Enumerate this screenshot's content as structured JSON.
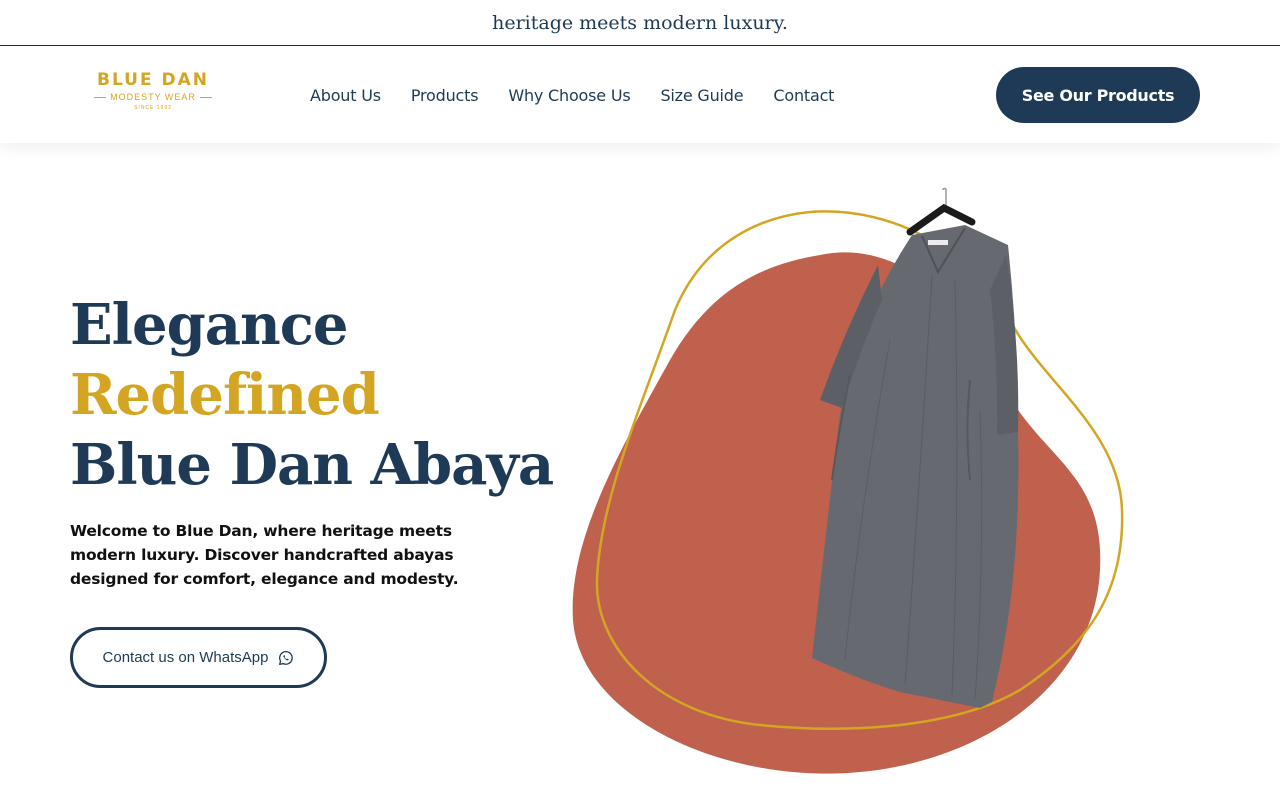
{
  "topbar": {
    "text": "heritage meets modern luxury."
  },
  "logo": {
    "title": "BLUE DAN",
    "subtitle": "MODESTY WEAR",
    "since": "SINCE 1992"
  },
  "nav": {
    "items": [
      {
        "label": "About Us"
      },
      {
        "label": "Products"
      },
      {
        "label": "Why Choose Us"
      },
      {
        "label": "Size Guide"
      },
      {
        "label": "Contact"
      }
    ]
  },
  "header_cta": {
    "label": "See Our Products"
  },
  "hero": {
    "title_line1": "Elegance",
    "title_line2": "Redefined",
    "title_line3": "Blue Dan Abaya",
    "description": "Welcome to Blue Dan, where heritage meets modern luxury. Discover handcrafted abayas designed for comfort, elegance and modesty.",
    "whatsapp_label": "Contact us on WhatsApp"
  },
  "icons": {
    "whatsapp": "whatsapp-icon"
  },
  "colors": {
    "navy": "#1f3a56",
    "gold": "#d4a523",
    "terracotta": "#bf614d",
    "abaya_gray": "#666a70"
  }
}
